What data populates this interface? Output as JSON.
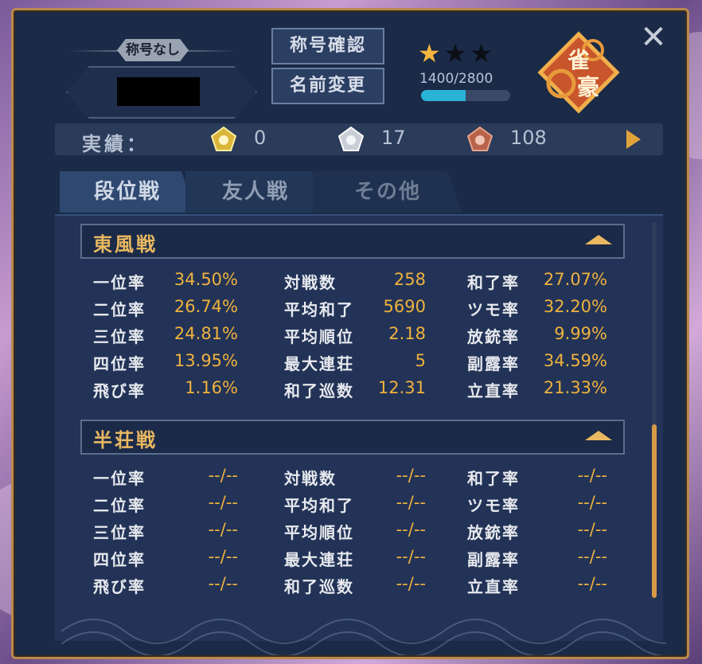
{
  "header": {
    "title_chip": "称号なし",
    "btn_title_confirm": "称号確認",
    "btn_name_change": "名前変更",
    "rank_points": "1400/2800",
    "rank_progress": 0.5,
    "stars": [
      {
        "icon": "star-filled-icon",
        "color": "#f2b53f"
      },
      {
        "icon": "star-empty-icon",
        "color": "#0b0e16"
      },
      {
        "icon": "star-empty-icon",
        "color": "#0b0e16"
      }
    ],
    "emblem_text": "雀豪",
    "close_symbol": "✕"
  },
  "achievements": {
    "label": "実績：",
    "gold": "0",
    "silver": "17",
    "bronze": "108",
    "colors": {
      "gold": "#d9b53a",
      "silver": "#c9ced6",
      "bronze": "#b8634a"
    }
  },
  "tabs": [
    {
      "label": "段位戦"
    },
    {
      "label": "友人戦"
    },
    {
      "label": "その他"
    }
  ],
  "sections": [
    {
      "title": "東風戦",
      "col1": [
        {
          "label": "一位率",
          "value": "34.50%"
        },
        {
          "label": "二位率",
          "value": "26.74%"
        },
        {
          "label": "三位率",
          "value": "24.81%"
        },
        {
          "label": "四位率",
          "value": "13.95%"
        },
        {
          "label": "飛び率",
          "value": "1.16%"
        }
      ],
      "col2": [
        {
          "label": "対戦数",
          "value": "258"
        },
        {
          "label": "平均和了",
          "value": "5690"
        },
        {
          "label": "平均順位",
          "value": "2.18"
        },
        {
          "label": "最大連荘",
          "value": "5"
        },
        {
          "label": "和了巡数",
          "value": "12.31"
        }
      ],
      "col3": [
        {
          "label": "和了率",
          "value": "27.07%"
        },
        {
          "label": "ツモ率",
          "value": "32.20%"
        },
        {
          "label": "放銃率",
          "value": "9.99%"
        },
        {
          "label": "副露率",
          "value": "34.59%"
        },
        {
          "label": "立直率",
          "value": "21.33%"
        }
      ]
    },
    {
      "title": "半荘戦",
      "col1": [
        {
          "label": "一位率",
          "value": "--/--"
        },
        {
          "label": "二位率",
          "value": "--/--"
        },
        {
          "label": "三位率",
          "value": "--/--"
        },
        {
          "label": "四位率",
          "value": "--/--"
        },
        {
          "label": "飛び率",
          "value": "--/--"
        }
      ],
      "col2": [
        {
          "label": "対戦数",
          "value": "--/--"
        },
        {
          "label": "平均和了",
          "value": "--/--"
        },
        {
          "label": "平均順位",
          "value": "--/--"
        },
        {
          "label": "最大連荘",
          "value": "--/--"
        },
        {
          "label": "和了巡数",
          "value": "--/--"
        }
      ],
      "col3": [
        {
          "label": "和了率",
          "value": "--/--"
        },
        {
          "label": "ツモ率",
          "value": "--/--"
        },
        {
          "label": "放銃率",
          "value": "--/--"
        },
        {
          "label": "副露率",
          "value": "--/--"
        },
        {
          "label": "立直率",
          "value": "--/--"
        }
      ]
    }
  ]
}
